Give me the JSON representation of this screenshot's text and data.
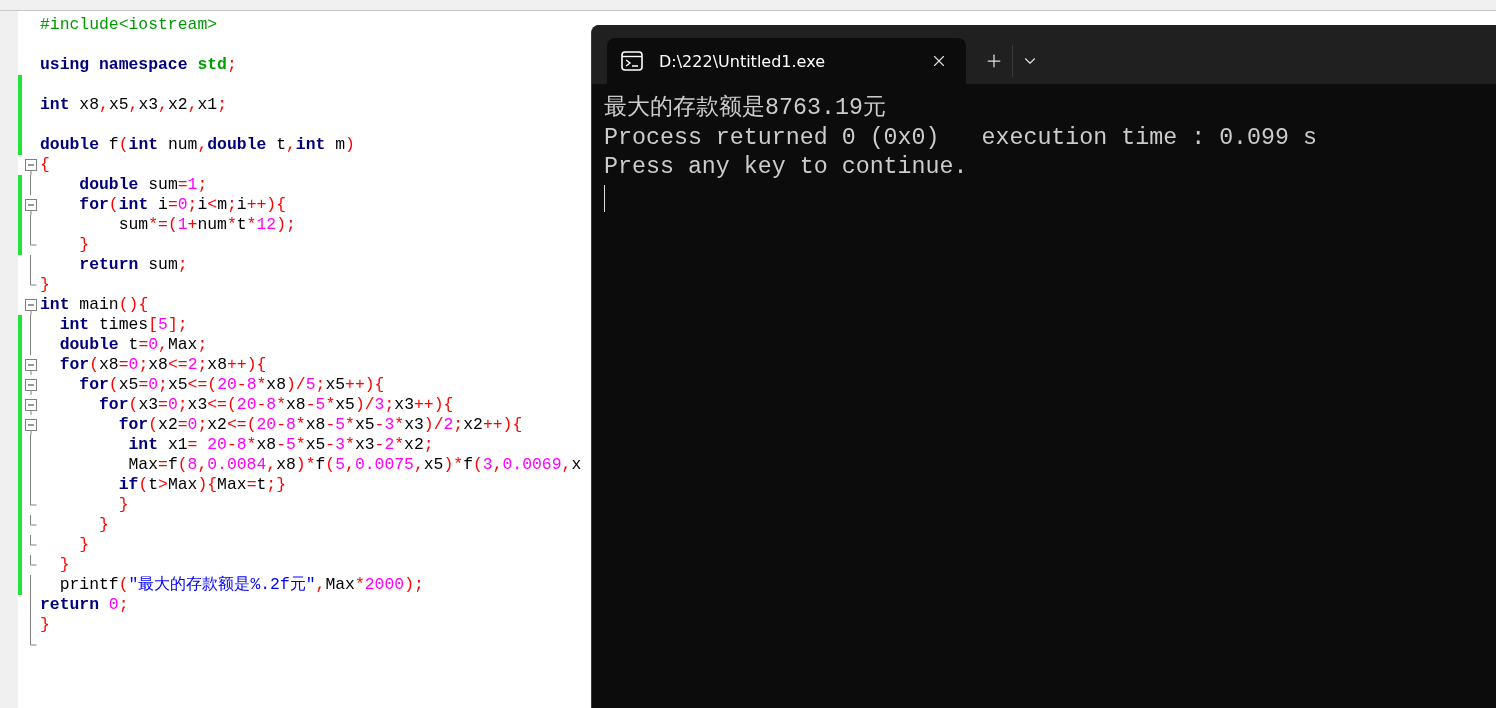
{
  "editor": {
    "lines": [
      {
        "changed": false,
        "kind": "plain",
        "tokens": [
          {
            "kind": "pre",
            "text": "#include<iostream>"
          }
        ]
      },
      {
        "changed": false,
        "kind": "plain"
      },
      {
        "changed": false,
        "kind": "plain",
        "tokens": [
          {
            "kind": "kw",
            "text": "using namespace"
          },
          {
            "kind": "ns",
            "text": " std"
          },
          {
            "kind": "op",
            "text": ";"
          }
        ]
      },
      {
        "changed": true,
        "kind": "plain"
      },
      {
        "changed": true,
        "kind": "plain",
        "tokens": [
          {
            "kind": "kw",
            "text": "int"
          },
          {
            "kind": "id",
            "text": " x8"
          },
          {
            "kind": "op",
            "text": ","
          },
          {
            "kind": "id",
            "text": "x5"
          },
          {
            "kind": "op",
            "text": ","
          },
          {
            "kind": "id",
            "text": "x3"
          },
          {
            "kind": "op",
            "text": ","
          },
          {
            "kind": "id",
            "text": "x2"
          },
          {
            "kind": "op",
            "text": ","
          },
          {
            "kind": "id",
            "text": "x1"
          },
          {
            "kind": "op",
            "text": ";"
          }
        ]
      },
      {
        "changed": true,
        "kind": "plain"
      },
      {
        "changed": true,
        "kind": "plain",
        "tokens": [
          {
            "kind": "kw",
            "text": "double"
          },
          {
            "kind": "id",
            "text": " f"
          },
          {
            "kind": "op",
            "text": "("
          },
          {
            "kind": "kw",
            "text": "int"
          },
          {
            "kind": "id",
            "text": " num"
          },
          {
            "kind": "op",
            "text": ","
          },
          {
            "kind": "kw",
            "text": "double"
          },
          {
            "kind": "id",
            "text": " t"
          },
          {
            "kind": "op",
            "text": ","
          },
          {
            "kind": "kw",
            "text": "int"
          },
          {
            "kind": "id",
            "text": " m"
          },
          {
            "kind": "op",
            "text": ")"
          }
        ]
      },
      {
        "changed": false,
        "kind": "foldstart",
        "tokens": [
          {
            "kind": "op",
            "text": "{"
          }
        ]
      },
      {
        "changed": true,
        "kind": "guide",
        "tokens": [
          {
            "kind": "kw",
            "text": "    double"
          },
          {
            "kind": "id",
            "text": " sum"
          },
          {
            "kind": "op",
            "text": "="
          },
          {
            "kind": "num",
            "text": "1"
          },
          {
            "kind": "op",
            "text": ";"
          }
        ]
      },
      {
        "changed": true,
        "kind": "foldstart",
        "tokens": [
          {
            "kind": "kw",
            "text": "    for"
          },
          {
            "kind": "op",
            "text": "("
          },
          {
            "kind": "kw",
            "text": "int"
          },
          {
            "kind": "id",
            "text": " i"
          },
          {
            "kind": "op",
            "text": "="
          },
          {
            "kind": "num",
            "text": "0"
          },
          {
            "kind": "op",
            "text": ";"
          },
          {
            "kind": "id",
            "text": "i"
          },
          {
            "kind": "op",
            "text": "<"
          },
          {
            "kind": "id",
            "text": "m"
          },
          {
            "kind": "op",
            "text": ";"
          },
          {
            "kind": "id",
            "text": "i"
          },
          {
            "kind": "op",
            "text": "++){"
          }
        ]
      },
      {
        "changed": true,
        "kind": "guide",
        "tokens": [
          {
            "kind": "id",
            "text": "        sum"
          },
          {
            "kind": "op",
            "text": "*=("
          },
          {
            "kind": "num",
            "text": "1"
          },
          {
            "kind": "op",
            "text": "+"
          },
          {
            "kind": "id",
            "text": "num"
          },
          {
            "kind": "op",
            "text": "*"
          },
          {
            "kind": "id",
            "text": "t"
          },
          {
            "kind": "op",
            "text": "*"
          },
          {
            "kind": "num",
            "text": "12"
          },
          {
            "kind": "op",
            "text": ");"
          }
        ]
      },
      {
        "changed": true,
        "kind": "foldend",
        "tokens": [
          {
            "kind": "op",
            "text": "    }"
          }
        ]
      },
      {
        "changed": false,
        "kind": "guide",
        "tokens": [
          {
            "kind": "kw",
            "text": "    return"
          },
          {
            "kind": "id",
            "text": " sum"
          },
          {
            "kind": "op",
            "text": ";"
          }
        ]
      },
      {
        "changed": false,
        "kind": "foldend",
        "tokens": [
          {
            "kind": "op",
            "text": "}"
          }
        ]
      },
      {
        "changed": false,
        "kind": "foldstart",
        "tokens": [
          {
            "kind": "kw",
            "text": "int"
          },
          {
            "kind": "id",
            "text": " main"
          },
          {
            "kind": "op",
            "text": "(){"
          }
        ]
      },
      {
        "changed": true,
        "kind": "guide",
        "tokens": [
          {
            "kind": "kw",
            "text": "  int"
          },
          {
            "kind": "id",
            "text": " times"
          },
          {
            "kind": "op",
            "text": "["
          },
          {
            "kind": "num",
            "text": "5"
          },
          {
            "kind": "op",
            "text": "];"
          }
        ]
      },
      {
        "changed": true,
        "kind": "guide",
        "tokens": [
          {
            "kind": "kw",
            "text": "  double"
          },
          {
            "kind": "id",
            "text": " t"
          },
          {
            "kind": "op",
            "text": "="
          },
          {
            "kind": "num",
            "text": "0"
          },
          {
            "kind": "op",
            "text": ","
          },
          {
            "kind": "id",
            "text": "Max"
          },
          {
            "kind": "op",
            "text": ";"
          }
        ]
      },
      {
        "changed": true,
        "kind": "foldstart",
        "tokens": [
          {
            "kind": "kw",
            "text": "  for"
          },
          {
            "kind": "op",
            "text": "("
          },
          {
            "kind": "id",
            "text": "x8"
          },
          {
            "kind": "op",
            "text": "="
          },
          {
            "kind": "num",
            "text": "0"
          },
          {
            "kind": "op",
            "text": ";"
          },
          {
            "kind": "id",
            "text": "x8"
          },
          {
            "kind": "op",
            "text": "<="
          },
          {
            "kind": "num",
            "text": "2"
          },
          {
            "kind": "op",
            "text": ";"
          },
          {
            "kind": "id",
            "text": "x8"
          },
          {
            "kind": "op",
            "text": "++){"
          }
        ]
      },
      {
        "changed": true,
        "kind": "foldstart",
        "tokens": [
          {
            "kind": "kw",
            "text": "    for"
          },
          {
            "kind": "op",
            "text": "("
          },
          {
            "kind": "id",
            "text": "x5"
          },
          {
            "kind": "op",
            "text": "="
          },
          {
            "kind": "num",
            "text": "0"
          },
          {
            "kind": "op",
            "text": ";"
          },
          {
            "kind": "id",
            "text": "x5"
          },
          {
            "kind": "op",
            "text": "<=("
          },
          {
            "kind": "num",
            "text": "20"
          },
          {
            "kind": "op",
            "text": "-"
          },
          {
            "kind": "num",
            "text": "8"
          },
          {
            "kind": "op",
            "text": "*"
          },
          {
            "kind": "id",
            "text": "x8"
          },
          {
            "kind": "op",
            "text": ")/"
          },
          {
            "kind": "num",
            "text": "5"
          },
          {
            "kind": "op",
            "text": ";"
          },
          {
            "kind": "id",
            "text": "x5"
          },
          {
            "kind": "op",
            "text": "++){"
          }
        ]
      },
      {
        "changed": true,
        "kind": "foldstart",
        "tokens": [
          {
            "kind": "kw",
            "text": "      for"
          },
          {
            "kind": "op",
            "text": "("
          },
          {
            "kind": "id",
            "text": "x3"
          },
          {
            "kind": "op",
            "text": "="
          },
          {
            "kind": "num",
            "text": "0"
          },
          {
            "kind": "op",
            "text": ";"
          },
          {
            "kind": "id",
            "text": "x3"
          },
          {
            "kind": "op",
            "text": "<=("
          },
          {
            "kind": "num",
            "text": "20"
          },
          {
            "kind": "op",
            "text": "-"
          },
          {
            "kind": "num",
            "text": "8"
          },
          {
            "kind": "op",
            "text": "*"
          },
          {
            "kind": "id",
            "text": "x8"
          },
          {
            "kind": "op",
            "text": "-"
          },
          {
            "kind": "num",
            "text": "5"
          },
          {
            "kind": "op",
            "text": "*"
          },
          {
            "kind": "id",
            "text": "x5"
          },
          {
            "kind": "op",
            "text": ")/"
          },
          {
            "kind": "num",
            "text": "3"
          },
          {
            "kind": "op",
            "text": ";"
          },
          {
            "kind": "id",
            "text": "x3"
          },
          {
            "kind": "op",
            "text": "++){"
          }
        ]
      },
      {
        "changed": true,
        "kind": "foldstart",
        "tokens": [
          {
            "kind": "kw",
            "text": "        for"
          },
          {
            "kind": "op",
            "text": "("
          },
          {
            "kind": "id",
            "text": "x2"
          },
          {
            "kind": "op",
            "text": "="
          },
          {
            "kind": "num",
            "text": "0"
          },
          {
            "kind": "op",
            "text": ";"
          },
          {
            "kind": "id",
            "text": "x2"
          },
          {
            "kind": "op",
            "text": "<=("
          },
          {
            "kind": "num",
            "text": "20"
          },
          {
            "kind": "op",
            "text": "-"
          },
          {
            "kind": "num",
            "text": "8"
          },
          {
            "kind": "op",
            "text": "*"
          },
          {
            "kind": "id",
            "text": "x8"
          },
          {
            "kind": "op",
            "text": "-"
          },
          {
            "kind": "num",
            "text": "5"
          },
          {
            "kind": "op",
            "text": "*"
          },
          {
            "kind": "id",
            "text": "x5"
          },
          {
            "kind": "op",
            "text": "-"
          },
          {
            "kind": "num",
            "text": "3"
          },
          {
            "kind": "op",
            "text": "*"
          },
          {
            "kind": "id",
            "text": "x3"
          },
          {
            "kind": "op",
            "text": ")/"
          },
          {
            "kind": "num",
            "text": "2"
          },
          {
            "kind": "op",
            "text": ";"
          },
          {
            "kind": "id",
            "text": "x2"
          },
          {
            "kind": "op",
            "text": "++){"
          }
        ]
      },
      {
        "changed": true,
        "kind": "guide",
        "tokens": [
          {
            "kind": "kw",
            "text": "         int"
          },
          {
            "kind": "id",
            "text": " x1"
          },
          {
            "kind": "op",
            "text": "="
          },
          {
            "kind": "num",
            "text": " 20"
          },
          {
            "kind": "op",
            "text": "-"
          },
          {
            "kind": "num",
            "text": "8"
          },
          {
            "kind": "op",
            "text": "*"
          },
          {
            "kind": "id",
            "text": "x8"
          },
          {
            "kind": "op",
            "text": "-"
          },
          {
            "kind": "num",
            "text": "5"
          },
          {
            "kind": "op",
            "text": "*"
          },
          {
            "kind": "id",
            "text": "x5"
          },
          {
            "kind": "op",
            "text": "-"
          },
          {
            "kind": "num",
            "text": "3"
          },
          {
            "kind": "op",
            "text": "*"
          },
          {
            "kind": "id",
            "text": "x3"
          },
          {
            "kind": "op",
            "text": "-"
          },
          {
            "kind": "num",
            "text": "2"
          },
          {
            "kind": "op",
            "text": "*"
          },
          {
            "kind": "id",
            "text": "x2"
          },
          {
            "kind": "op",
            "text": ";"
          }
        ]
      },
      {
        "changed": true,
        "kind": "guide",
        "tokens": [
          {
            "kind": "id",
            "text": "         Max"
          },
          {
            "kind": "op",
            "text": "="
          },
          {
            "kind": "id",
            "text": "f"
          },
          {
            "kind": "op",
            "text": "("
          },
          {
            "kind": "num",
            "text": "8"
          },
          {
            "kind": "op",
            "text": ","
          },
          {
            "kind": "num",
            "text": "0.0084"
          },
          {
            "kind": "op",
            "text": ","
          },
          {
            "kind": "id",
            "text": "x8"
          },
          {
            "kind": "op",
            "text": ")*"
          },
          {
            "kind": "id",
            "text": "f"
          },
          {
            "kind": "op",
            "text": "("
          },
          {
            "kind": "num",
            "text": "5"
          },
          {
            "kind": "op",
            "text": ","
          },
          {
            "kind": "num",
            "text": "0.0075"
          },
          {
            "kind": "op",
            "text": ","
          },
          {
            "kind": "id",
            "text": "x5"
          },
          {
            "kind": "op",
            "text": ")*"
          },
          {
            "kind": "id",
            "text": "f"
          },
          {
            "kind": "op",
            "text": "("
          },
          {
            "kind": "num",
            "text": "3"
          },
          {
            "kind": "op",
            "text": ","
          },
          {
            "kind": "num",
            "text": "0.0069"
          },
          {
            "kind": "op",
            "text": ","
          },
          {
            "kind": "id",
            "text": "x"
          }
        ]
      },
      {
        "changed": true,
        "kind": "guide",
        "tokens": [
          {
            "kind": "kw",
            "text": "        if"
          },
          {
            "kind": "op",
            "text": "("
          },
          {
            "kind": "id",
            "text": "t"
          },
          {
            "kind": "op",
            "text": ">"
          },
          {
            "kind": "id",
            "text": "Max"
          },
          {
            "kind": "op",
            "text": "){"
          },
          {
            "kind": "id",
            "text": "Max"
          },
          {
            "kind": "op",
            "text": "="
          },
          {
            "kind": "id",
            "text": "t"
          },
          {
            "kind": "op",
            "text": ";}"
          }
        ]
      },
      {
        "changed": true,
        "kind": "foldend",
        "tokens": [
          {
            "kind": "op",
            "text": "        }"
          }
        ]
      },
      {
        "changed": true,
        "kind": "foldend",
        "tokens": [
          {
            "kind": "op",
            "text": "      }"
          }
        ]
      },
      {
        "changed": true,
        "kind": "foldend",
        "tokens": [
          {
            "kind": "op",
            "text": "    }"
          }
        ]
      },
      {
        "changed": true,
        "kind": "foldend",
        "tokens": [
          {
            "kind": "op",
            "text": "  }"
          }
        ]
      },
      {
        "changed": true,
        "kind": "guide",
        "tokens": [
          {
            "kind": "id",
            "text": "  printf"
          },
          {
            "kind": "op",
            "text": "("
          },
          {
            "kind": "str",
            "text": "\"最大的存款额是%.2f元\""
          },
          {
            "kind": "op",
            "text": ","
          },
          {
            "kind": "id",
            "text": "Max"
          },
          {
            "kind": "op",
            "text": "*"
          },
          {
            "kind": "num",
            "text": "2000"
          },
          {
            "kind": "op",
            "text": ");"
          }
        ]
      },
      {
        "changed": false,
        "kind": "guide",
        "tokens": [
          {
            "kind": "kw",
            "text": "return"
          },
          {
            "kind": "num",
            "text": " 0"
          },
          {
            "kind": "op",
            "text": ";"
          }
        ]
      },
      {
        "changed": false,
        "kind": "guide",
        "tokens": [
          {
            "kind": "op",
            "text": "}"
          }
        ]
      },
      {
        "changed": false,
        "kind": "foldend"
      }
    ]
  },
  "console": {
    "tab": {
      "title": "D:\\222\\Untitled1.exe",
      "selected": true
    },
    "output": [
      "最大的存款额是8763.19元",
      "Process returned 0 (0x0)   execution time : 0.099 s",
      "Press any key to continue."
    ]
  }
}
